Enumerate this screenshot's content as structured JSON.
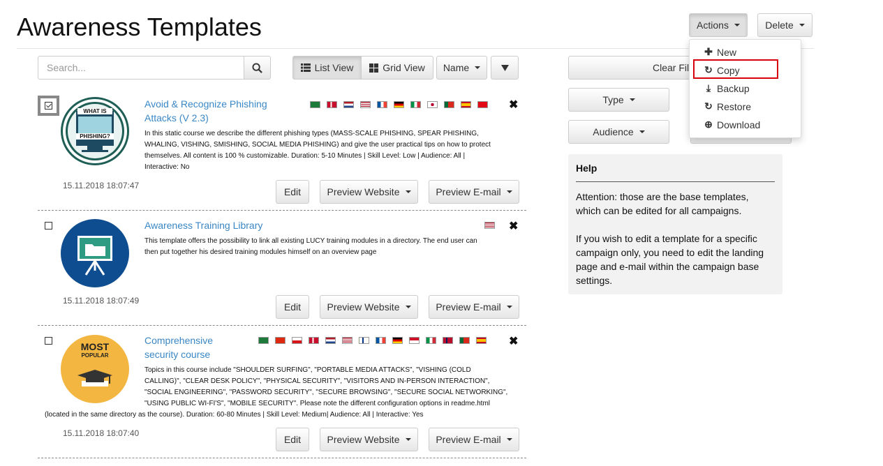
{
  "page": {
    "title": "Awareness Templates"
  },
  "header": {
    "actions_label": "Actions",
    "delete_label": "Delete"
  },
  "actions_menu": {
    "items": [
      {
        "label": "New",
        "icon": "plus-icon"
      },
      {
        "label": "Copy",
        "icon": "refresh-icon",
        "highlighted": true
      },
      {
        "label": "Backup",
        "icon": "download-icon"
      },
      {
        "label": "Restore",
        "icon": "refresh-icon"
      },
      {
        "label": "Download",
        "icon": "circle-download-icon"
      }
    ]
  },
  "toolbar": {
    "search_placeholder": "Search...",
    "search_value": "",
    "list_view_label": "List View",
    "grid_view_label": "Grid View",
    "sort_label": "Name"
  },
  "filters": {
    "clear_label": "Clear Fil",
    "type_label": "Type",
    "audience_label": "Audience"
  },
  "items": [
    {
      "title_line1": "Avoid & Recognize Phishing",
      "title_line2": "Attacks (V 2.3)",
      "desc": [
        "In this static course we describe the different phishing types (MASS-SCALE PHISHING, SPEAR PHISHING,",
        "WHALING, VISHING, SMISHING, SOCIAL MEDIA PHISHING) and give the user practical tips on how to protect",
        "themselves. All content is 100 % customizable. Duration: 5-10 Minutes | Skill Level: Low | Audience: All |",
        "Interactive: No"
      ],
      "date": "15.11.2018 18:07:47",
      "checked": true,
      "thumb_text_1": "WHAT IS",
      "thumb_text_2": "PHISHING?",
      "flags": [
        "sa",
        "dk",
        "nl",
        "us",
        "fr",
        "de",
        "it",
        "jp",
        "pt",
        "es",
        "tr"
      ]
    },
    {
      "title_line1": "Awareness Training Library",
      "desc": [
        "This template offers the possibility to link all existing LUCY training modules in a directory. The end user can",
        "then put together his desired training modules himself on an overview page"
      ],
      "date": "15.11.2018 18:07:49",
      "checked": false,
      "flags": [
        "us"
      ]
    },
    {
      "title_line1": "Comprehensive",
      "title_line2": "security course",
      "desc": [
        "Topics in this course include \"SHOULDER SURFING\", \"PORTABLE MEDIA ATTACKS\", \"VISHING (COLD",
        "CALLING)\", \"CLEAR DESK POLICY\", \"PHYSICAL SECURITY\", \"VISITORS AND IN-PERSON INTERACTION\",",
        "\"SOCIAL ENGINEERING\", \"PASSWORD SECURITY\", \"SECURE BROWSING\", \"SECURE SOCIAL NETWORKING\",",
        "\"USING PUBLIC WI-FI'S\", \"MOBILE SECURITY\". Please note the different configuration options in readme.html",
        "(located in the same directory as the course). Duration: 60-80 Minutes | Skill Level: Medium| Audience: All | Interactive: Yes"
      ],
      "date": "15.11.2018 18:07:40",
      "checked": false,
      "thumb_text_1": "MOST",
      "thumb_text_2": "POPULAR",
      "flags": [
        "sa",
        "cn",
        "cz",
        "dk",
        "nl",
        "us",
        "fi",
        "fr",
        "de",
        "id",
        "it",
        "no",
        "pt",
        "es"
      ]
    }
  ],
  "item_buttons": {
    "edit_label": "Edit",
    "preview_website_label": "Preview Website",
    "preview_email_label": "Preview E-mail"
  },
  "help": {
    "title": "Help",
    "paragraph1": [
      "Attention: those are the base templates,",
      "which can be edited for all campaigns."
    ],
    "paragraph2": [
      "If you wish to edit a template for a specific",
      "campaign only, you need to edit the landing",
      "page and e-mail within the campaign base",
      "settings."
    ]
  },
  "colors": {
    "link": "#3a87c6",
    "highlight_box": "#d9000d"
  }
}
